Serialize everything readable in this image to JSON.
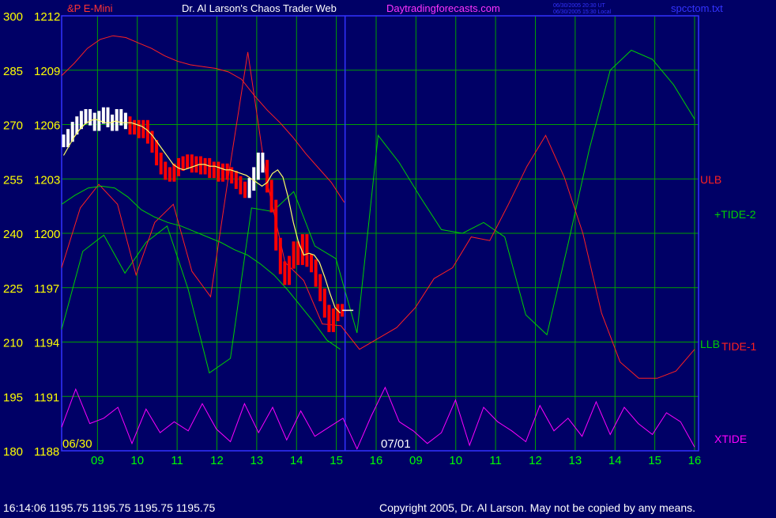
{
  "header": {
    "symbol": "&P E-Mini",
    "title": "Dr. Al Larson's Chaos Trader Web",
    "site": "Daytradingforecasts.com",
    "stamp_ut": "06/30/2005 20:30 UT",
    "stamp_local": "06/30/2005 15:30 Local",
    "file": "spcctom.txt"
  },
  "footer": {
    "quote": "16:14:06  1195.75 1195.75 1195.75 1195.75",
    "copyright": "Copyright 2005, Dr. Al Larson. May not be copied by any means."
  },
  "colors": {
    "background": "#000066",
    "grid": "#00a000",
    "axis_border": "#3333ff",
    "y_label_left": "#ffff00",
    "x_label": "#00ff00",
    "price_up": "#ffffff",
    "price_down": "#ff0000",
    "band": "#ff2020",
    "tide": "#00d000",
    "xtide": "#ff00ff",
    "average": "#ffff66",
    "trend": "#2020ff",
    "header_text": "#ffffff",
    "header_link": "#ff33ff",
    "header_file": "#3333ff"
  },
  "chart_data": {
    "type": "line",
    "title": "Dr. Al Larson's Chaos Trader Web",
    "x_ticks": [
      "09",
      "10",
      "11",
      "12",
      "13",
      "14",
      "15",
      "16",
      "09",
      "10",
      "11",
      "12",
      "13",
      "14",
      "15",
      "16"
    ],
    "date_labels": [
      "06/30",
      "07/01"
    ],
    "y_ticks_left": [
      "300",
      "285",
      "270",
      "255",
      "240",
      "225",
      "210",
      "195",
      "180"
    ],
    "y_ticks_price": [
      "1212",
      "1209",
      "1206",
      "1203",
      "1200",
      "1197",
      "1194",
      "1191",
      "1188"
    ],
    "y_range_price": [
      1188,
      1212
    ],
    "y_range_index": [
      180,
      300
    ],
    "grid": true,
    "right_labels": [
      "ULB",
      "+TIDE-2",
      "LLB",
      "TIDE-1",
      "XTIDE"
    ],
    "price_bars_close": [
      1205.1,
      1205.4,
      1205.8,
      1206.1,
      1206.4,
      1206.5,
      1206.3,
      1206.0,
      1206.4,
      1206.6,
      1206.2,
      1206.0,
      1206.5,
      1206.3,
      1206.1,
      1205.8,
      1205.9,
      1205.6,
      1205.9,
      1205.3,
      1204.8,
      1204.1,
      1203.6,
      1203.3,
      1203.2,
      1203.5,
      1203.8,
      1203.9,
      1204.0,
      1203.7,
      1203.9,
      1203.6,
      1203.8,
      1203.4,
      1203.6,
      1203.2,
      1203.5,
      1203.3,
      1203.1,
      1202.8,
      1202.5,
      1202.3,
      1202.7,
      1203.3,
      1204.1,
      1203.7,
      1202.6,
      1201.5,
      1199.4,
      1198.1,
      1197.5,
      1198.4,
      1199.2,
      1198.6,
      1199.6,
      1198.5,
      1198.2,
      1197.4,
      1196.6,
      1195.7,
      1194.9,
      1195.5,
      1195.75,
      1195.75
    ],
    "price_bar_type": [
      "up",
      "up",
      "up",
      "up",
      "up",
      "up",
      "up",
      "up",
      "up",
      "up",
      "up",
      "up",
      "up",
      "up",
      "up",
      "down",
      "down",
      "down",
      "down",
      "down",
      "down",
      "down",
      "down",
      "down",
      "down",
      "down",
      "down",
      "down",
      "down",
      "down",
      "down",
      "down",
      "down",
      "down",
      "down",
      "down",
      "down",
      "down",
      "down",
      "down",
      "down",
      "down",
      "up",
      "up",
      "up",
      "up",
      "down",
      "down",
      "down",
      "down",
      "down",
      "down",
      "down",
      "down",
      "down",
      "down",
      "down",
      "down",
      "down",
      "down",
      "down",
      "down",
      "down",
      "down"
    ],
    "yellow_average": [
      1204.3,
      1204.8,
      1205.3,
      1205.7,
      1206.0,
      1206.2,
      1206.3,
      1206.2,
      1206.1,
      1206.1,
      1206.2,
      1206.1,
      1206.1,
      1206.1,
      1206.0,
      1205.9,
      1205.7,
      1205.4,
      1205.0,
      1204.6,
      1204.2,
      1203.8,
      1203.6,
      1203.5,
      1203.6,
      1203.7,
      1203.8,
      1203.8,
      1203.7,
      1203.7,
      1203.6,
      1203.5,
      1203.5,
      1203.4,
      1203.3,
      1203.2,
      1203.0,
      1202.8,
      1202.6,
      1202.8,
      1203.3,
      1203.5,
      1203.1,
      1202.0,
      1200.6,
      1199.5,
      1198.8,
      1198.9,
      1198.8,
      1198.4,
      1197.6,
      1196.7,
      1195.9,
      1195.6
    ],
    "series": [
      {
        "name": "ULB",
        "y": [
          1208.7,
          1209.4,
          1210.2,
          1210.7,
          1210.9,
          1210.8,
          1210.5,
          1210.2,
          1209.8,
          1209.5,
          1209.3,
          1209.2,
          1209.1,
          1208.9,
          1208.5,
          1207.6,
          1206.8,
          1206.1,
          1205.3,
          1204.4,
          1203.6,
          1202.8,
          1201.7
        ]
      },
      {
        "name": "LLB",
        "y": [
          1201.6,
          1202.1,
          1202.5,
          1202.6,
          1202.5,
          1202.0,
          1201.3,
          1200.9,
          1200.6,
          1200.4,
          1200.1,
          1199.8,
          1199.5,
          1199.1,
          1198.8,
          1198.3,
          1197.7,
          1196.9,
          1196.0,
          1195.1,
          1194.1,
          1193.6
        ]
      },
      {
        "name": "TIDE-1",
        "y": [
          1198.1,
          1201.4,
          1202.7,
          1201.6,
          1197.7,
          1200.6,
          1201.6,
          1197.9,
          1196.5,
          1203.4,
          1210.0,
          1203.0,
          1198.4,
          1197.4,
          1195.0,
          1194.9,
          1193.6,
          1194.2,
          1194.8,
          1195.9,
          1197.5,
          1198.1,
          1199.8,
          1199.6,
          1201.6,
          1203.7,
          1205.4,
          1203.1,
          1200.0,
          1195.6,
          1192.9,
          1192.0,
          1192.0,
          1192.4,
          1193.6
        ]
      },
      {
        "name": "+TIDE-2",
        "y": [
          1194.7,
          1199.0,
          1199.9,
          1197.8,
          1199.5,
          1200.4,
          1196.9,
          1192.3,
          1193.1,
          1201.4,
          1201.2,
          1202.3,
          1199.3,
          1198.6,
          1194.5,
          1205.4,
          1203.9,
          1202.0,
          1200.2,
          1200.0,
          1200.6,
          1199.8,
          1195.5,
          1194.4,
          1199.4,
          1204.6,
          1209.0,
          1210.1,
          1209.6,
          1208.2,
          1206.3
        ]
      },
      {
        "name": "XTIDE",
        "y": [
          1189.3,
          1191.4,
          1189.5,
          1189.8,
          1190.4,
          1188.4,
          1190.3,
          1189.0,
          1189.6,
          1189.1,
          1190.6,
          1189.2,
          1188.5,
          1190.6,
          1189.0,
          1190.4,
          1188.6,
          1190.2,
          1188.8,
          1189.3,
          1189.8,
          1188.1,
          1189.9,
          1191.5,
          1189.6,
          1189.1,
          1188.4,
          1189.0,
          1190.8,
          1188.3,
          1190.4,
          1189.6,
          1189.1,
          1188.5,
          1190.5,
          1189.1,
          1189.8,
          1188.8,
          1190.7,
          1188.9,
          1190.4,
          1189.5,
          1188.9,
          1190.1,
          1189.6,
          1188.2
        ]
      }
    ]
  }
}
